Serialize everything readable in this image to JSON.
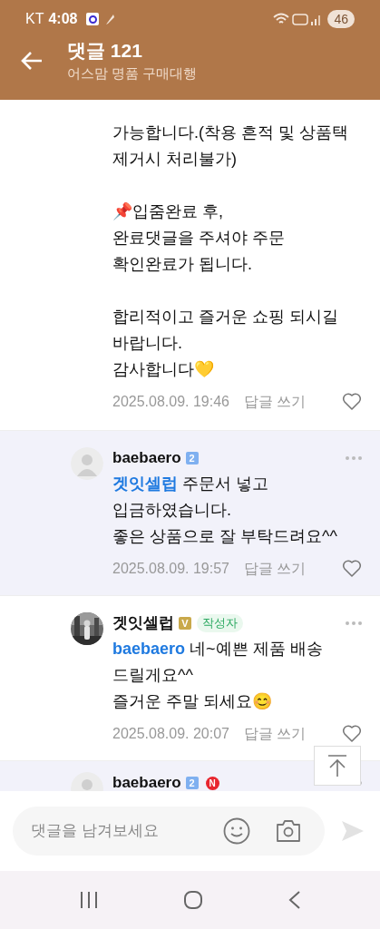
{
  "status_bar": {
    "carrier": "KT",
    "time": "4:08",
    "battery": "46"
  },
  "header": {
    "title": "댓글 121",
    "subtitle": "어스맘 명품 구매대행"
  },
  "comments": [
    {
      "kind": "continuation",
      "reply": false,
      "text": "가능합니다.(착용 흔적 및 상품택\n제거시 처리불가)\n\n📌입줌완료 후,\n완료댓글을 주셔야 주문\n확인완료가 됩니다.\n\n합리적이고 즐거운 쇼핑 되시길\n바랍니다.\n감사합니다💛",
      "date": "2025.08.09. 19:46",
      "reply_label": "답글 쓰기",
      "liked": false
    },
    {
      "kind": "comment",
      "reply": true,
      "avatar": {
        "kind": "default"
      },
      "author": "baebaero",
      "grade": {
        "text": "2",
        "color": "#7fb0f0"
      },
      "mention": "겟잇셀럽",
      "text": " 주문서 넣고\n입금하였습니다.\n좋은 상품으로 잘 부탁드려요^^",
      "date": "2025.08.09. 19:57",
      "reply_label": "답글 쓰기",
      "liked": false
    },
    {
      "kind": "comment",
      "reply": false,
      "author": "겟잇셀럽",
      "grade": {
        "text": "V",
        "color": "#c9a94a"
      },
      "writer_tag": "작성자",
      "mention": "baebaero",
      "text": " 네~예쁜 제품 배송\n드릴게요^^\n즐거운 주말 되세요😊",
      "date": "2025.08.09. 20:07",
      "reply_label": "답글 쓰기",
      "liked": false
    },
    {
      "kind": "comment",
      "reply": true,
      "avatar": {
        "kind": "default"
      },
      "author": "baebaero",
      "grade": {
        "text": "2",
        "color": "#7fb0f0"
      },
      "new_badge": "N"
    }
  ],
  "composer": {
    "placeholder": "댓글을 남겨보세요"
  }
}
